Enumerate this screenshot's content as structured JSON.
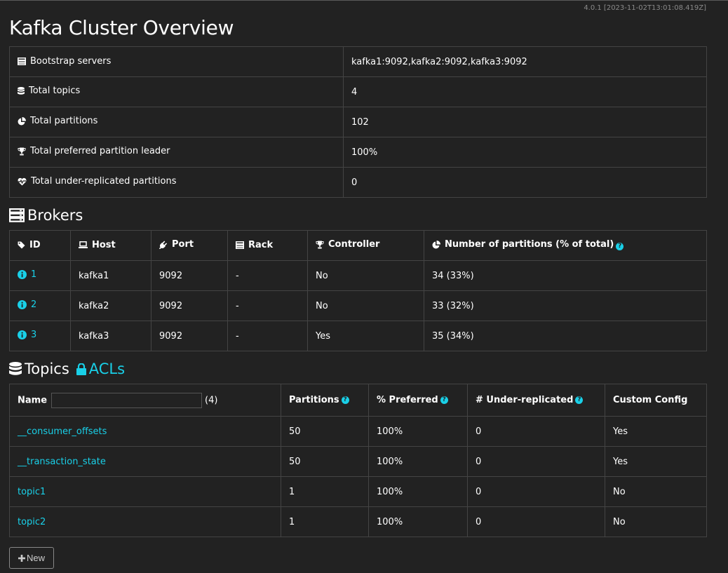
{
  "version": "4.0.1 [2023-11-02T13:01:08.419Z]",
  "title": "Kafka Cluster Overview",
  "overview": [
    {
      "icon": "server-icon",
      "label": "Bootstrap servers",
      "value": "kafka1:9092,kafka2:9092,kafka3:9092"
    },
    {
      "icon": "database-icon",
      "label": "Total topics",
      "value": "4"
    },
    {
      "icon": "pie-chart-icon",
      "label": "Total partitions",
      "value": "102"
    },
    {
      "icon": "trophy-icon",
      "label": "Total preferred partition leader",
      "value": "100%"
    },
    {
      "icon": "heartbeat-icon",
      "label": "Total under-replicated partitions",
      "value": "0"
    }
  ],
  "brokers": {
    "title": "Brokers",
    "headers": {
      "id": "ID",
      "host": "Host",
      "port": "Port",
      "rack": "Rack",
      "controller": "Controller",
      "partitions": "Number of partitions (% of total)"
    },
    "rows": [
      {
        "id": "1",
        "host": "kafka1",
        "port": "9092",
        "rack": "-",
        "controller": "No",
        "partitions": "34 (33%)"
      },
      {
        "id": "2",
        "host": "kafka2",
        "port": "9092",
        "rack": "-",
        "controller": "No",
        "partitions": "33 (32%)"
      },
      {
        "id": "3",
        "host": "kafka3",
        "port": "9092",
        "rack": "-",
        "controller": "Yes",
        "partitions": "35 (34%)"
      }
    ]
  },
  "topics": {
    "title": "Topics",
    "acls_label": "ACLs",
    "headers": {
      "name": "Name",
      "count": "(4)",
      "partitions": "Partitions",
      "preferred": "% Preferred",
      "under": "# Under-replicated",
      "custom": "Custom Config"
    },
    "filter_value": "",
    "rows": [
      {
        "name": "__consumer_offsets",
        "partitions": "50",
        "preferred": "100%",
        "under": "0",
        "custom": "Yes"
      },
      {
        "name": "__transaction_state",
        "partitions": "50",
        "preferred": "100%",
        "under": "0",
        "custom": "Yes"
      },
      {
        "name": "topic1",
        "partitions": "1",
        "preferred": "100%",
        "under": "0",
        "custom": "No"
      },
      {
        "name": "topic2",
        "partitions": "1",
        "preferred": "100%",
        "under": "0",
        "custom": "No"
      }
    ]
  },
  "new_button": "New",
  "colors": {
    "background": "#222222",
    "link": "#19d0e8",
    "border": "#444444"
  }
}
